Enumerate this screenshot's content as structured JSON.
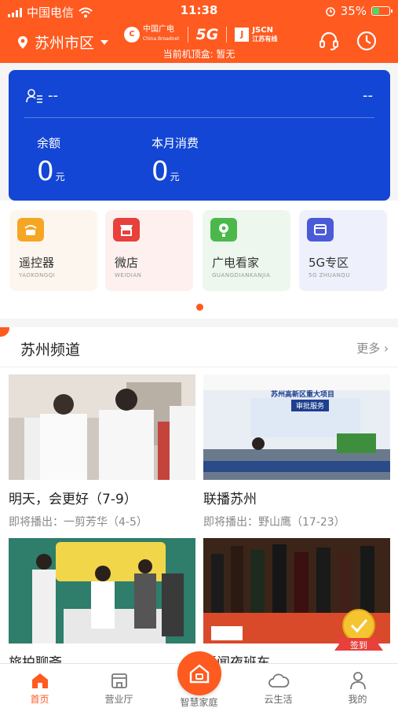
{
  "status_bar": {
    "carrier": "中国电信",
    "time": "11:38",
    "battery": "35%",
    "battery_level": 0.35
  },
  "header": {
    "city": "苏州市区",
    "brand_cbn_line1": "中国广电",
    "brand_cbn_line2": "China Broadnet",
    "brand_5g": "5G",
    "brand_jscn_line1": "JSCN",
    "brand_jscn_line2": "江苏有线",
    "set_top_box": "当前机顶盒: 暂无"
  },
  "account": {
    "user": "--",
    "right": "--",
    "balance_label": "余额",
    "balance_value": "0",
    "balance_unit": "元",
    "monthly_label": "本月消费",
    "monthly_value": "0",
    "monthly_unit": "元"
  },
  "tiles": [
    {
      "name": "遥控器",
      "pinyin": "YAOKONGQI",
      "color": "#f5a623"
    },
    {
      "name": "微店",
      "pinyin": "WEIDIAN",
      "color": "#e8403a"
    },
    {
      "name": "广电看家",
      "pinyin": "GUANGDIANKANJIA",
      "color": "#4cb84c"
    },
    {
      "name": "5G专区",
      "pinyin": "5G ZHUANQU",
      "color": "#4a5bd8"
    }
  ],
  "channel": {
    "title": "苏州频道",
    "more": "更多",
    "videos": [
      {
        "title": "明天，会更好（7-9）",
        "subtitle": "即将播出：一剪芳华（4-5）"
      },
      {
        "title": "联播苏州",
        "subtitle": "即将播出：野山鹰（17-23）",
        "thumb_banner": "苏州高新区重大项目",
        "thumb_sub": "审批服务"
      },
      {
        "title": "旅拍聊斋",
        "subtitle": ""
      },
      {
        "title": "新闻夜班车",
        "subtitle": ""
      }
    ]
  },
  "signin_badge": "签到",
  "nav": {
    "home": "首页",
    "hall": "营业厅",
    "smart_home": "智慧家庭",
    "cloud": "云生活",
    "mine": "我的"
  },
  "colors": {
    "brand": "#ff5a1f",
    "card": "#1346d4"
  }
}
